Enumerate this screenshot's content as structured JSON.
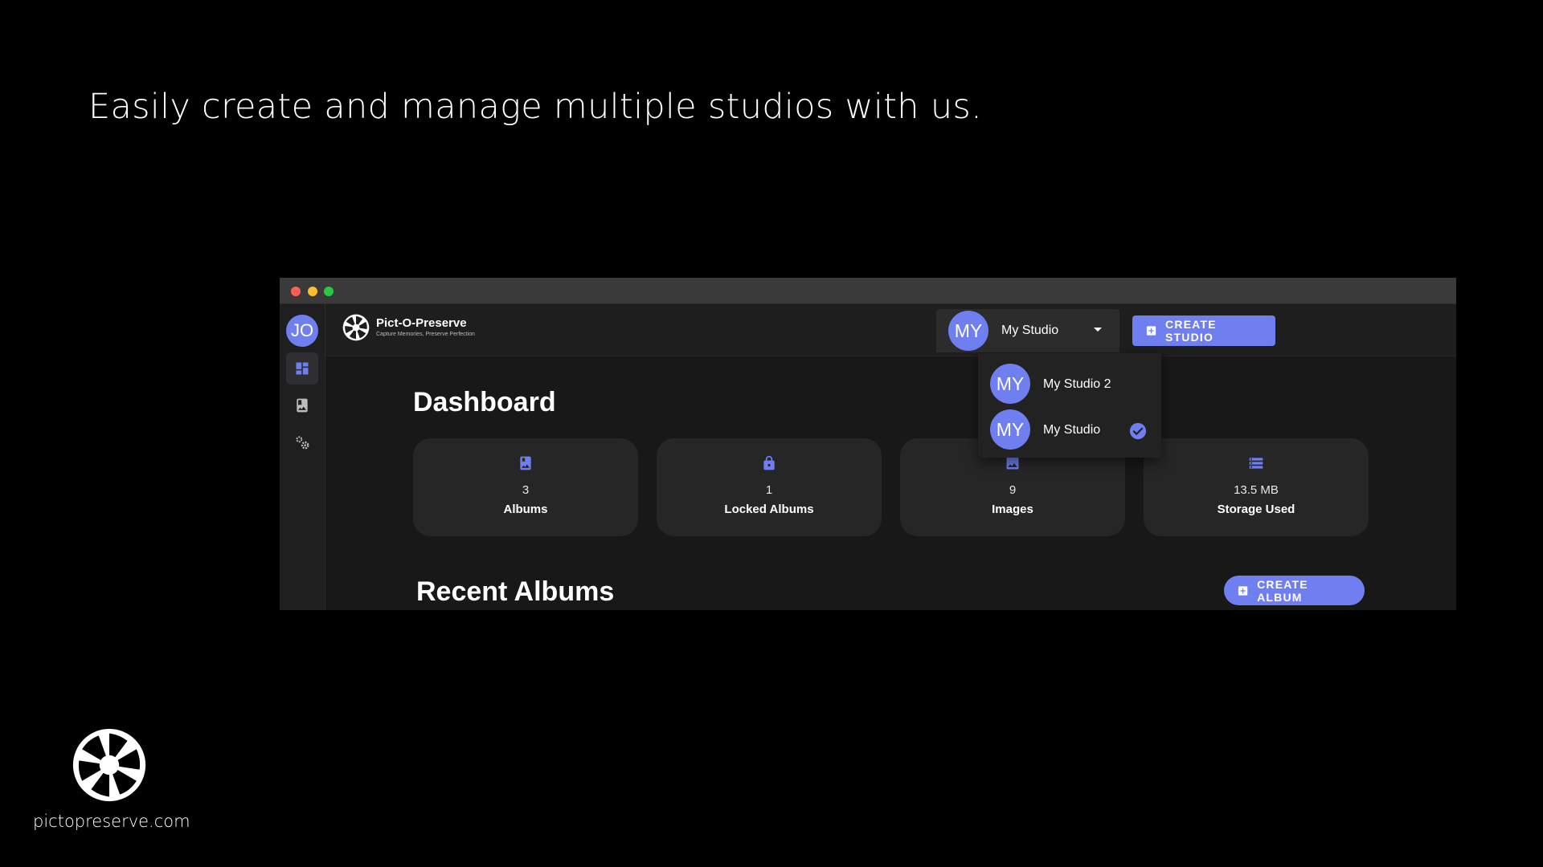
{
  "slide": {
    "headline": "Easily create and manage multiple studios with us.",
    "website": "pictopreserve.com"
  },
  "sidebar": {
    "user_initials": "JO",
    "items": [
      {
        "icon": "dashboard-icon",
        "active": true
      },
      {
        "icon": "photo-album-icon",
        "active": false
      },
      {
        "icon": "settings-gears-icon",
        "active": false
      }
    ]
  },
  "header": {
    "app_name": "Pict-O-Preserve",
    "tagline": "Capture Memories, Preserve Perfection",
    "selected_studio": {
      "initials": "MY",
      "name": "My Studio"
    },
    "create_studio_label": "CREATE STUDIO",
    "theme_icon": "lightbulb-icon",
    "help_icon": "help-icon"
  },
  "studio_dropdown": {
    "options": [
      {
        "initials": "MY",
        "name": "My Studio 2",
        "selected": false
      },
      {
        "initials": "MY",
        "name": "My Studio",
        "selected": true
      }
    ]
  },
  "dashboard": {
    "title": "Dashboard",
    "stats": [
      {
        "icon": "album-icon",
        "value": "3",
        "label": "Albums"
      },
      {
        "icon": "lock-icon",
        "value": "1",
        "label": "Locked Albums"
      },
      {
        "icon": "image-icon",
        "value": "9",
        "label": "Images"
      },
      {
        "icon": "storage-icon",
        "value": "13.5 MB",
        "label": "Storage Used"
      }
    ]
  },
  "recent_albums": {
    "title": "Recent Albums",
    "create_album_label": "CREATE ALBUM"
  },
  "colors": {
    "accent": "#6f7ff0",
    "background": "#000000",
    "panel": "#181818",
    "card": "#262626"
  }
}
